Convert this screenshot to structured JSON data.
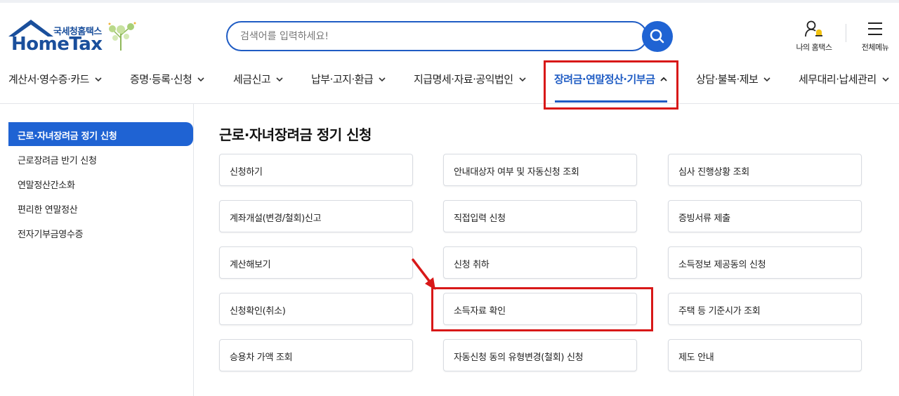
{
  "header": {
    "logo_small": "국세청홈택스",
    "logo_big": "HomeTax",
    "search_placeholder": "검색어를 입력하세요!",
    "my_hometax": "나의 홈택스",
    "all_menu": "전체메뉴"
  },
  "gnb": {
    "items": [
      {
        "label": "계산서·영수증·카드"
      },
      {
        "label": "증명·등록·신청"
      },
      {
        "label": "세금신고"
      },
      {
        "label": "납부·고지·환급"
      },
      {
        "label": "지급명세·자료·공익법인"
      },
      {
        "label": "장려금·연말정산·기부금",
        "active": true
      },
      {
        "label": "상담·불복·제보"
      },
      {
        "label": "세무대리·납세관리"
      }
    ]
  },
  "sidebar": {
    "items": [
      {
        "label": "근로·자녀장려금 정기 신청",
        "active": true
      },
      {
        "label": "근로장려금 반기 신청"
      },
      {
        "label": "연말정산간소화"
      },
      {
        "label": "편리한 연말정산"
      },
      {
        "label": "전자기부금영수증"
      }
    ]
  },
  "main": {
    "title": "근로·자녀장려금 정기 신청",
    "cards": [
      "신청하기",
      "안내대상자 여부 및 자동신청 조회",
      "심사 진행상황 조회",
      "계좌개설(변경/철회)신고",
      "직접입력 신청",
      "증빙서류 제출",
      "계산해보기",
      "신청 취하",
      "소득정보 제공동의 신청",
      "신청확인(취소)",
      "소득자료 확인",
      "주택 등 기준시가 조회",
      "승용차 가액 조회",
      "자동신청 동의 유형변경(철회) 신청",
      "제도 안내"
    ]
  },
  "colors": {
    "brand_blue": "#1f63d3",
    "highlight_red": "#d81818"
  }
}
